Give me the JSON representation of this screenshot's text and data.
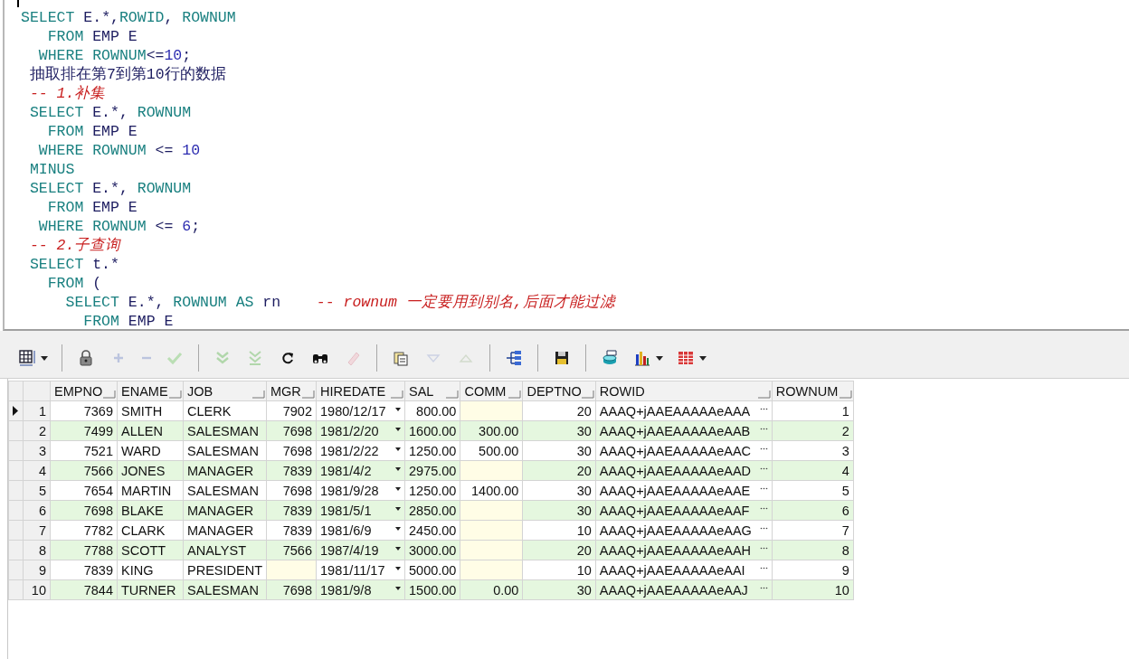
{
  "editor": {
    "lines": [
      {
        "tokens": [
          {
            "kind": "keyword",
            "text": "SELECT"
          },
          {
            "kind": "name",
            "text": " E.*,"
          },
          {
            "kind": "keyword",
            "text": "ROWID"
          },
          {
            "kind": "name",
            "text": ", "
          },
          {
            "kind": "keyword",
            "text": "ROWNUM"
          }
        ]
      },
      {
        "tokens": [
          {
            "kind": "keyword",
            "text": "   FROM"
          },
          {
            "kind": "name",
            "text": " EMP E"
          }
        ]
      },
      {
        "tokens": [
          {
            "kind": "keyword",
            "text": "  WHERE ROWNUM"
          },
          {
            "kind": "name",
            "text": "<="
          },
          {
            "kind": "number",
            "text": "10"
          },
          {
            "kind": "name",
            "text": ";"
          }
        ]
      },
      {
        "tokens": [
          {
            "kind": "name",
            "text": " 抽取排在第7到第10行的数据"
          }
        ]
      },
      {
        "tokens": [
          {
            "kind": "comment",
            "text": " -- 1.补集"
          }
        ]
      },
      {
        "tokens": [
          {
            "kind": "keyword",
            "text": " SELECT"
          },
          {
            "kind": "name",
            "text": " E.*, "
          },
          {
            "kind": "keyword",
            "text": "ROWNUM"
          }
        ]
      },
      {
        "tokens": [
          {
            "kind": "keyword",
            "text": "   FROM"
          },
          {
            "kind": "name",
            "text": " EMP E"
          }
        ]
      },
      {
        "tokens": [
          {
            "kind": "keyword",
            "text": "  WHERE ROWNUM"
          },
          {
            "kind": "name",
            "text": " <= "
          },
          {
            "kind": "number",
            "text": "10"
          }
        ]
      },
      {
        "tokens": [
          {
            "kind": "keyword",
            "text": " MINUS"
          }
        ]
      },
      {
        "tokens": [
          {
            "kind": "keyword",
            "text": " SELECT"
          },
          {
            "kind": "name",
            "text": " E.*, "
          },
          {
            "kind": "keyword",
            "text": "ROWNUM"
          }
        ]
      },
      {
        "tokens": [
          {
            "kind": "keyword",
            "text": "   FROM"
          },
          {
            "kind": "name",
            "text": " EMP E"
          }
        ]
      },
      {
        "tokens": [
          {
            "kind": "keyword",
            "text": "  WHERE ROWNUM"
          },
          {
            "kind": "name",
            "text": " <= "
          },
          {
            "kind": "number",
            "text": "6"
          },
          {
            "kind": "name",
            "text": ";"
          }
        ]
      },
      {
        "tokens": [
          {
            "kind": "comment",
            "text": " -- 2.子查询"
          }
        ]
      },
      {
        "tokens": [
          {
            "kind": "keyword",
            "text": " SELECT"
          },
          {
            "kind": "name",
            "text": " t.*"
          }
        ]
      },
      {
        "tokens": [
          {
            "kind": "keyword",
            "text": "   FROM"
          },
          {
            "kind": "name",
            "text": " ("
          }
        ]
      },
      {
        "tokens": [
          {
            "kind": "keyword",
            "text": "     SELECT"
          },
          {
            "kind": "name",
            "text": " E.*, "
          },
          {
            "kind": "keyword",
            "text": "ROWNUM AS"
          },
          {
            "kind": "name",
            "text": " rn    "
          },
          {
            "kind": "comment",
            "text": "-- rownum 一定要用到别名,后面才能过滤"
          }
        ]
      },
      {
        "tokens": [
          {
            "kind": "keyword",
            "text": "       FROM"
          },
          {
            "kind": "name",
            "text": " EMP E"
          }
        ]
      }
    ]
  },
  "toolbar": {
    "groups": [
      [
        {
          "kind": "grid",
          "dropdown": true,
          "disabled": false
        }
      ],
      [
        {
          "kind": "lock",
          "dropdown": false,
          "disabled": false
        },
        {
          "kind": "plus",
          "dropdown": false,
          "disabled": true
        },
        {
          "kind": "minus",
          "dropdown": false,
          "disabled": true
        },
        {
          "kind": "check",
          "dropdown": false,
          "disabled": true
        }
      ],
      [
        {
          "kind": "double-down",
          "dropdown": false,
          "disabled": true
        },
        {
          "kind": "double-down-line",
          "dropdown": false,
          "disabled": true
        },
        {
          "kind": "refresh",
          "dropdown": false,
          "disabled": false
        },
        {
          "kind": "binoculars",
          "dropdown": false,
          "disabled": false
        },
        {
          "kind": "eraser",
          "dropdown": false,
          "disabled": true
        }
      ],
      [
        {
          "kind": "documents",
          "dropdown": false,
          "disabled": false
        },
        {
          "kind": "triangle-down",
          "dropdown": false,
          "disabled": true
        },
        {
          "kind": "triangle-up",
          "dropdown": false,
          "disabled": true
        }
      ],
      [
        {
          "kind": "tree",
          "dropdown": false,
          "disabled": false
        }
      ],
      [
        {
          "kind": "save",
          "dropdown": false,
          "disabled": false
        }
      ],
      [
        {
          "kind": "database",
          "dropdown": false,
          "disabled": false
        },
        {
          "kind": "bar-chart",
          "dropdown": true,
          "disabled": false
        },
        {
          "kind": "table",
          "dropdown": true,
          "disabled": false
        }
      ]
    ]
  },
  "grid": {
    "columns": [
      {
        "label": "EMPNO",
        "kind": "number"
      },
      {
        "label": "ENAME",
        "kind": "text"
      },
      {
        "label": "JOB",
        "kind": "text"
      },
      {
        "label": "MGR",
        "kind": "number"
      },
      {
        "label": "HIREDATE",
        "kind": "date"
      },
      {
        "label": "SAL",
        "kind": "number"
      },
      {
        "label": "COMM",
        "kind": "number"
      },
      {
        "label": "DEPTNO",
        "kind": "number"
      },
      {
        "label": "ROWID",
        "kind": "rowid"
      },
      {
        "label": "ROWNUM",
        "kind": "number"
      }
    ],
    "rows": [
      {
        "number": "1",
        "selected": true,
        "cells": [
          "7369",
          "SMITH",
          "CLERK",
          "7902",
          "1980/12/17",
          "800.00",
          null,
          "20",
          "AAAQ+jAAEAAAAAeAAA",
          "1"
        ]
      },
      {
        "number": "2",
        "selected": false,
        "cells": [
          "7499",
          "ALLEN",
          "SALESMAN",
          "7698",
          "1981/2/20",
          "1600.00",
          "300.00",
          "30",
          "AAAQ+jAAEAAAAAeAAB",
          "2"
        ]
      },
      {
        "number": "3",
        "selected": false,
        "cells": [
          "7521",
          "WARD",
          "SALESMAN",
          "7698",
          "1981/2/22",
          "1250.00",
          "500.00",
          "30",
          "AAAQ+jAAEAAAAAeAAC",
          "3"
        ]
      },
      {
        "number": "4",
        "selected": false,
        "cells": [
          "7566",
          "JONES",
          "MANAGER",
          "7839",
          "1981/4/2",
          "2975.00",
          null,
          "20",
          "AAAQ+jAAEAAAAAeAAD",
          "4"
        ]
      },
      {
        "number": "5",
        "selected": false,
        "cells": [
          "7654",
          "MARTIN",
          "SALESMAN",
          "7698",
          "1981/9/28",
          "1250.00",
          "1400.00",
          "30",
          "AAAQ+jAAEAAAAAeAAE",
          "5"
        ]
      },
      {
        "number": "6",
        "selected": false,
        "cells": [
          "7698",
          "BLAKE",
          "MANAGER",
          "7839",
          "1981/5/1",
          "2850.00",
          null,
          "30",
          "AAAQ+jAAEAAAAAeAAF",
          "6"
        ]
      },
      {
        "number": "7",
        "selected": false,
        "cells": [
          "7782",
          "CLARK",
          "MANAGER",
          "7839",
          "1981/6/9",
          "2450.00",
          null,
          "10",
          "AAAQ+jAAEAAAAAeAAG",
          "7"
        ]
      },
      {
        "number": "8",
        "selected": false,
        "cells": [
          "7788",
          "SCOTT",
          "ANALYST",
          "7566",
          "1987/4/19",
          "3000.00",
          null,
          "20",
          "AAAQ+jAAEAAAAAeAAH",
          "8"
        ]
      },
      {
        "number": "9",
        "selected": false,
        "cells": [
          "7839",
          "KING",
          "PRESIDENT",
          null,
          "1981/11/17",
          "5000.00",
          null,
          "10",
          "AAAQ+jAAEAAAAAeAAI",
          "9"
        ]
      },
      {
        "number": "10",
        "selected": false,
        "cells": [
          "7844",
          "TURNER",
          "SALESMAN",
          "7698",
          "1981/9/8",
          "1500.00",
          "0.00",
          "30",
          "AAAQ+jAAEAAAAAeAAJ",
          "10"
        ]
      }
    ]
  }
}
